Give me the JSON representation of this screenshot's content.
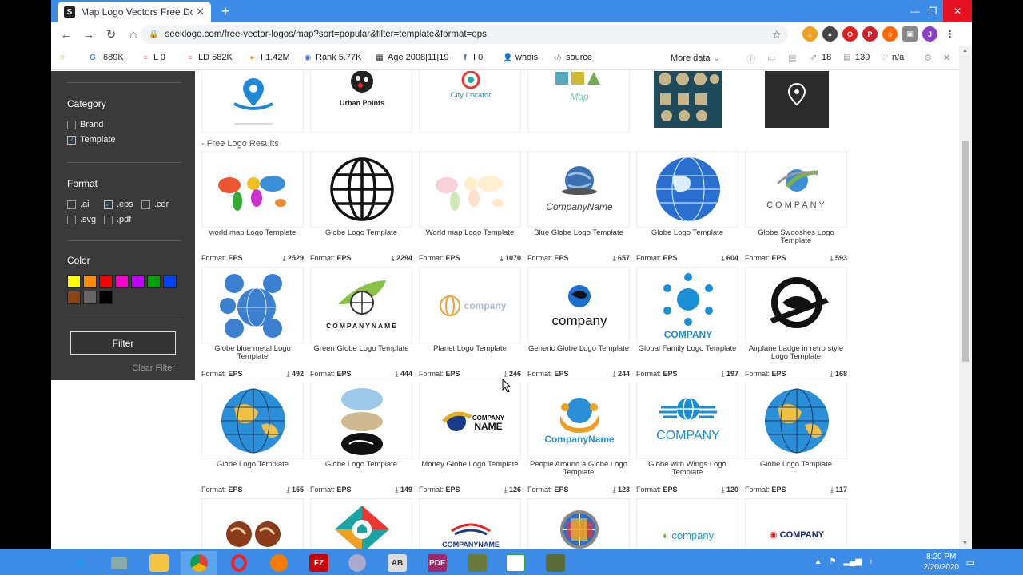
{
  "browser": {
    "tab_title": "Map Logo Vectors Free Downloa",
    "tab_favicon": "S",
    "url": "seeklogo.com/free-vector-logos/map?sort=popular&filter=template&format=eps"
  },
  "seoquake": {
    "g": "I689K",
    "l": "L 0",
    "ld": "LD 582K",
    "i": "I 1.42M",
    "rank": "Rank 5.77K",
    "age": "Age 2008|11|19",
    "fb": "I 0",
    "whois": "whois",
    "source": "source",
    "more_data": "More data",
    "links": "18",
    "words": "139",
    "na": "n/a"
  },
  "sidebar": {
    "category_title": "Category",
    "categories": [
      {
        "label": "Brand",
        "checked": false
      },
      {
        "label": "Template",
        "checked": true
      }
    ],
    "format_title": "Format",
    "formats": [
      {
        "label": ".ai",
        "checked": false
      },
      {
        "label": ".eps",
        "checked": true
      },
      {
        "label": ".cdr",
        "checked": false
      },
      {
        "label": ".svg",
        "checked": false
      },
      {
        "label": ".pdf",
        "checked": false
      }
    ],
    "color_title": "Color",
    "colors": [
      "#ffff00",
      "#ff8c00",
      "#ff0000",
      "#ff00cc",
      "#c000ff",
      "#00a000",
      "#0040ff",
      "#8b4513",
      "#666666",
      "#000000"
    ],
    "filter_label": "Filter",
    "clear_label": "Clear Filter"
  },
  "top_row": [
    {
      "text": ""
    },
    {
      "text": "Urban Points"
    },
    {
      "text": "City Locator"
    },
    {
      "text": "Map"
    },
    {
      "text": ""
    },
    {
      "text": ""
    }
  ],
  "section_title": "- Free Logo Results",
  "results": [
    {
      "caption": "world map Logo Template",
      "format": "EPS",
      "downloads": "2529",
      "art": "worldmap"
    },
    {
      "caption": "Globe Logo Template",
      "format": "EPS",
      "downloads": "2294",
      "art": "wireglobe"
    },
    {
      "caption": "World map Logo Template",
      "format": "EPS",
      "downloads": "1070",
      "art": "worldmap-pale"
    },
    {
      "caption": "Blue Globe Logo Template",
      "format": "EPS",
      "downloads": "657",
      "art": "companyname-globe"
    },
    {
      "caption": "Globe Logo Template",
      "format": "EPS",
      "downloads": "604",
      "art": "blueglobe"
    },
    {
      "caption": "Globe Swooshes Logo Template",
      "format": "EPS",
      "downloads": "593",
      "art": "swoosh"
    },
    {
      "caption": "Globe blue metal Logo Template",
      "format": "EPS",
      "downloads": "492",
      "art": "metal"
    },
    {
      "caption": "Green Globe Logo Template",
      "format": "EPS",
      "downloads": "444",
      "art": "green"
    },
    {
      "caption": "Planet Logo Template",
      "format": "EPS",
      "downloads": "246",
      "art": "planet"
    },
    {
      "caption": "Generic Globe Logo Template",
      "format": "EPS",
      "downloads": "244",
      "art": "generic"
    },
    {
      "caption": "Global Family Logo Template",
      "format": "EPS",
      "downloads": "197",
      "art": "family"
    },
    {
      "caption": "Airplane badge in retro style Logo Template",
      "format": "EPS",
      "downloads": "168",
      "art": "airplane"
    },
    {
      "caption": "Globe Logo Template",
      "format": "EPS",
      "downloads": "155",
      "art": "yellowglobe"
    },
    {
      "caption": "Globe Logo Template",
      "format": "EPS",
      "downloads": "149",
      "art": "stacked"
    },
    {
      "caption": "Money Globe Logo Template",
      "format": "EPS",
      "downloads": "126",
      "art": "money"
    },
    {
      "caption": "People Around a Globe Logo Template",
      "format": "EPS",
      "downloads": "123",
      "art": "people"
    },
    {
      "caption": "Globe with Wings Logo Template",
      "format": "EPS",
      "downloads": "120",
      "art": "wings"
    },
    {
      "caption": "Globe Logo Template",
      "format": "EPS",
      "downloads": "117",
      "art": "yellowglobe"
    }
  ],
  "labels": {
    "format_prefix": "Format:",
    "company": "COMPANY",
    "company_name": "CompanyName",
    "company_lower": "company",
    "companyname_caps": "COMPANYNAME",
    "company_name_caps": "COMPANY NAME"
  },
  "bottom_row": [
    "COMPANYNAME",
    "company",
    "COMPANY"
  ],
  "taskbar": {
    "time": "8:20 PM",
    "date": "2/20/2020"
  }
}
